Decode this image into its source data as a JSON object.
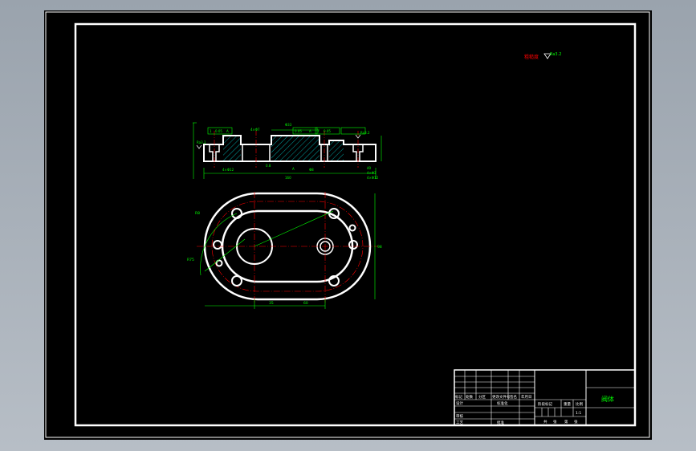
{
  "drawing": {
    "title": "阀体",
    "roughness_note": "粗糙度",
    "roughness_value": "Ra3.2",
    "colors": {
      "frame": "#ffffff",
      "dimension": "#00ff00",
      "centerline": "#ff0000",
      "hatch": "#00c8c8",
      "part": "#ffffff",
      "background": "#000000"
    }
  },
  "front_view": {
    "dim_labels": [
      "1",
      "0.05",
      "A",
      "4×Φ7",
      "0.05",
      "A",
      "1",
      "0.05"
    ],
    "dim_top": "Φ33",
    "roughness_left": "Ra3.2",
    "roughness_right": "Ra3.2",
    "bottom_labels": [
      "4×Φ12",
      "0.8",
      "A",
      "Φ8",
      "160"
    ],
    "right_labels": [
      "40",
      "4×Φ7",
      "4×Φ12"
    ]
  },
  "top_view": {
    "left_dim": "R8",
    "left_dim_2": "R75",
    "right_dim": "98",
    "bottom_dims": [
      "35",
      "60"
    ]
  },
  "title_block": {
    "header_cells": [
      "标记",
      "处数",
      "分区",
      "更改文件号",
      "签名",
      "年月日"
    ],
    "rows": [
      "设计",
      "",
      "审核",
      "工艺"
    ],
    "row_right": [
      "标准化",
      "",
      "",
      "批准"
    ],
    "stage_labels": [
      "阶段标记",
      "重量",
      "比例"
    ],
    "scale": "1:1",
    "sheet_labels": [
      "共",
      "张",
      "第",
      "张"
    ]
  }
}
